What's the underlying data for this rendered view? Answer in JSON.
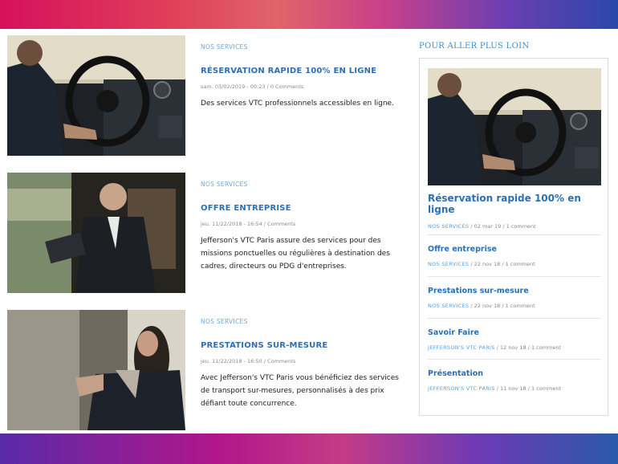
{
  "posts": [
    {
      "category": "NOS SERVICES",
      "title": "RÉSERVATION RAPIDE 100% EN LIGNE",
      "meta": "sam. 03/02/2019 - 00:23 / 0 Comments",
      "description": "Des services VTC professionnels accessibles en ligne."
    },
    {
      "category": "NOS SERVICES",
      "title": "OFFRE ENTREPRISE",
      "meta": "jeu. 11/22/2018 - 16:54 / Comments",
      "description": "Jefferson's VTC Paris assure des services pour des missions ponctuelles ou régulières à destination des cadres, directeurs ou PDG d'entreprises."
    },
    {
      "category": "NOS SERVICES",
      "title": "PRESTATIONS SUR-MESURE",
      "meta": "jeu. 11/22/2018 - 16:50 / Comments",
      "description": "Avec Jefferson's VTC Paris vous bénéficiez des services de transport sur-mesures, personnalisés à des prix défiant toute concurrence."
    }
  ],
  "sidebar": {
    "heading": "POUR ALLER PLUS LOIN",
    "featured": {
      "title": "Réservation rapide 100% en ligne",
      "category": "NOS SERVICES",
      "meta": "/ 02 mar 19 / 1 comment"
    },
    "items": [
      {
        "title": "Offre entreprise",
        "category": "NOS SERVICES",
        "meta": "/ 22 nov 18 / 1 comment"
      },
      {
        "title": "Prestations sur-mesure",
        "category": "NOS SERVICES",
        "meta": "/ 22 nov 18 / 1 comment"
      },
      {
        "title": "Savoir Faire",
        "category": "JEFFERSON'S VTC PARIS",
        "meta": "/ 12 nov 18 / 1 comment"
      },
      {
        "title": "Présentation",
        "category": "JEFFERSON'S VTC PARIS",
        "meta": "/ 11 nov 18 / 1 comment"
      }
    ]
  }
}
